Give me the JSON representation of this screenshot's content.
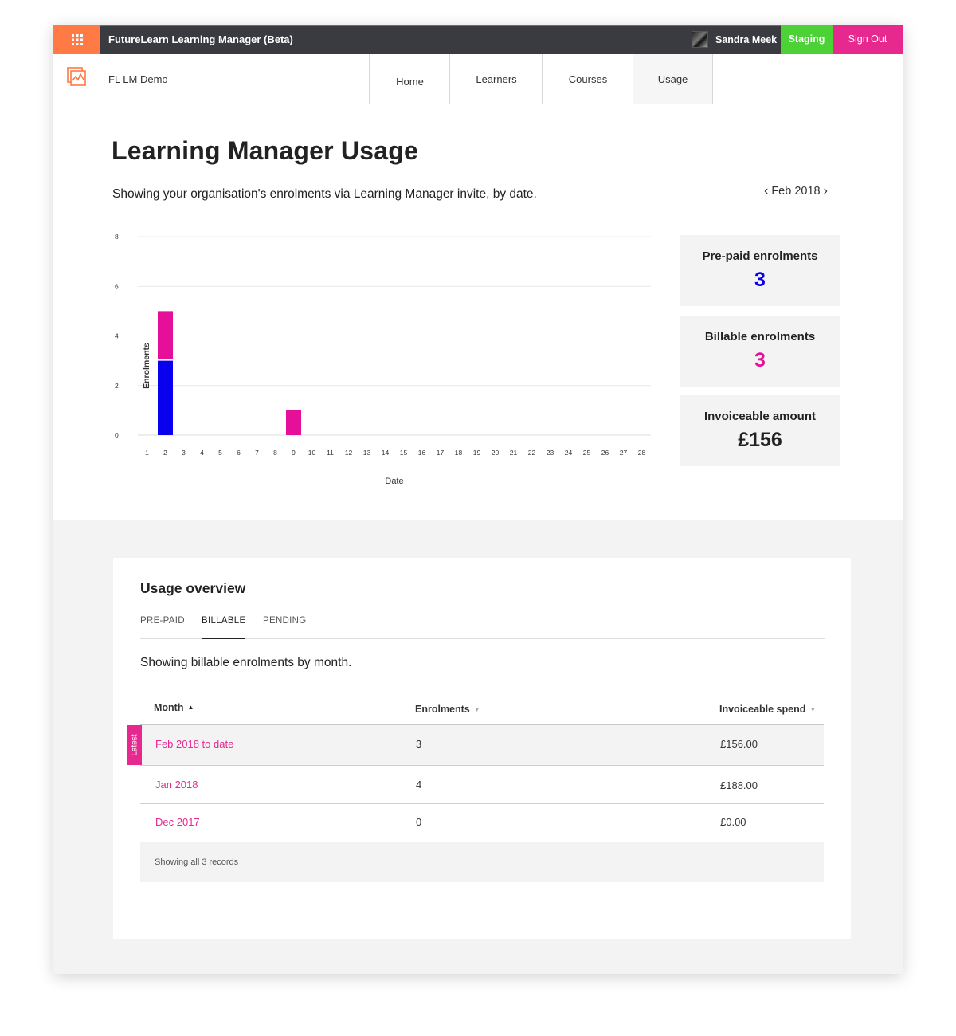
{
  "header": {
    "app_title": "FutureLearn Learning Manager (Beta)",
    "user_name": "Sandra Meek",
    "environment": "Staging",
    "sign_out": "Sign Out",
    "colors": {
      "bar": "#3a3b41",
      "apps": "#ff7a45",
      "staging": "#4cd137",
      "signout": "#e6288f"
    }
  },
  "nav": {
    "org_name": "FL LM Demo",
    "tabs": [
      "Home",
      "Learners",
      "Courses",
      "Usage"
    ],
    "active_tab": "Usage"
  },
  "page": {
    "title": "Learning Manager Usage",
    "description": "Showing your organisation's enrolments via Learning Manager invite, by date.",
    "month": "Feb 2018"
  },
  "chart_data": {
    "type": "bar",
    "stacked": true,
    "categories": [
      "1",
      "2",
      "3",
      "4",
      "5",
      "6",
      "7",
      "8",
      "9",
      "10",
      "11",
      "12",
      "13",
      "14",
      "15",
      "16",
      "17",
      "18",
      "19",
      "20",
      "21",
      "22",
      "23",
      "24",
      "25",
      "26",
      "27",
      "28"
    ],
    "series": [
      {
        "color": "#0a00f0",
        "values": [
          0,
          3,
          0,
          0,
          0,
          0,
          0,
          0,
          0,
          0,
          0,
          0,
          0,
          0,
          0,
          0,
          0,
          0,
          0,
          0,
          0,
          0,
          0,
          0,
          0,
          0,
          0,
          0
        ]
      },
      {
        "color": "#e60f9a",
        "values": [
          0,
          2,
          0,
          0,
          0,
          0,
          0,
          0,
          1,
          0,
          0,
          0,
          0,
          0,
          0,
          0,
          0,
          0,
          0,
          0,
          0,
          0,
          0,
          0,
          0,
          0,
          0,
          0
        ]
      }
    ],
    "yticks": [
      0,
      2,
      4,
      6,
      8
    ],
    "ylim": [
      0,
      8
    ],
    "xlabel": "Date",
    "ylabel": "Enrolments",
    "grid": true
  },
  "stats": [
    {
      "label": "Pre-paid enrolments",
      "value": "3",
      "color": "#0a00f0"
    },
    {
      "label": "Billable enrolments",
      "value": "3",
      "color": "#e60f9a"
    },
    {
      "label": "Invoiceable amount",
      "value": "£156",
      "color": "#222222"
    }
  ],
  "overview": {
    "title": "Usage overview",
    "tabs": [
      "PRE-PAID",
      "BILLABLE",
      "PENDING"
    ],
    "active_tab": "BILLABLE",
    "description": "Showing billable enrolments by month.",
    "columns": [
      "Month",
      "Enrolments",
      "Invoiceable spend"
    ],
    "latest_label": "Latest",
    "rows": [
      {
        "month": "Feb 2018 to date",
        "enrolments": "3",
        "spend": "£156.00"
      },
      {
        "month": "Jan 2018",
        "enrolments": "4",
        "spend": "£188.00"
      },
      {
        "month": "Dec 2017",
        "enrolments": "0",
        "spend": "£0.00"
      }
    ],
    "footer": "Showing all 3 records"
  }
}
